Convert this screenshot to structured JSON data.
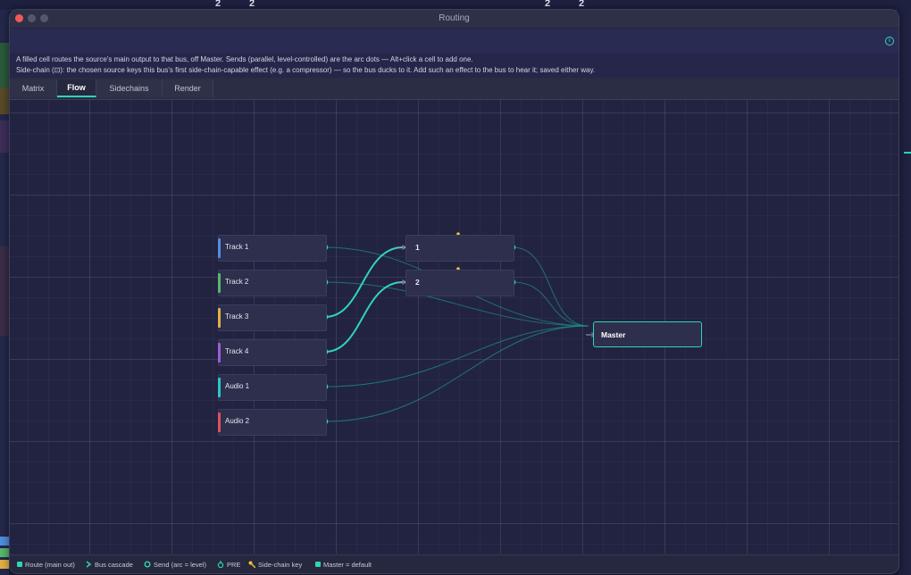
{
  "background_app": {
    "ruler_numbers": [
      "2",
      "2",
      "2",
      "2"
    ]
  },
  "window": {
    "title": "Routing"
  },
  "help": {
    "line1": "A filled cell routes the source's main output to that bus, off Master. Sends (parallel, level-controlled) are the arc dots — Alt+click a cell to add one.",
    "line2": "Side-chain (⊡): the chosen source keys this bus's first side-chain-capable effect (e.g. a compressor) — so the bus ducks to it. Add such an effect to the bus to hear it; saved either way."
  },
  "tabs": [
    {
      "label": "Matrix"
    },
    {
      "label": "Flow",
      "active": true
    },
    {
      "label": "Sidechains"
    },
    {
      "label": "Render"
    }
  ],
  "tracks": [
    {
      "name": "Track 1",
      "color": "#4f8fe0"
    },
    {
      "name": "Track 2",
      "color": "#58b86a"
    },
    {
      "name": "Track 3",
      "color": "#e3b047"
    },
    {
      "name": "Track 4",
      "color": "#9a5fd6"
    },
    {
      "name": "Audio 1",
      "color": "#2fc6c6"
    },
    {
      "name": "Audio 2",
      "color": "#e0505c"
    }
  ],
  "buses": [
    {
      "name": "1"
    },
    {
      "name": "2"
    }
  ],
  "master": {
    "name": "Master"
  },
  "legend": [
    {
      "label": "Route (main out)",
      "icon": "square-icon"
    },
    {
      "label": "Bus cascade",
      "icon": "chevron-right-icon"
    },
    {
      "label": "Send (arc = level)",
      "icon": "ring-icon"
    },
    {
      "label": "PRE",
      "icon": "pre-icon"
    },
    {
      "label": "Side-chain key",
      "icon": "key-icon"
    },
    {
      "label": "Master = default",
      "icon": "square-icon"
    }
  ],
  "colors": {
    "accent": "#2fd6b3",
    "send_dot": "#f0c030"
  }
}
